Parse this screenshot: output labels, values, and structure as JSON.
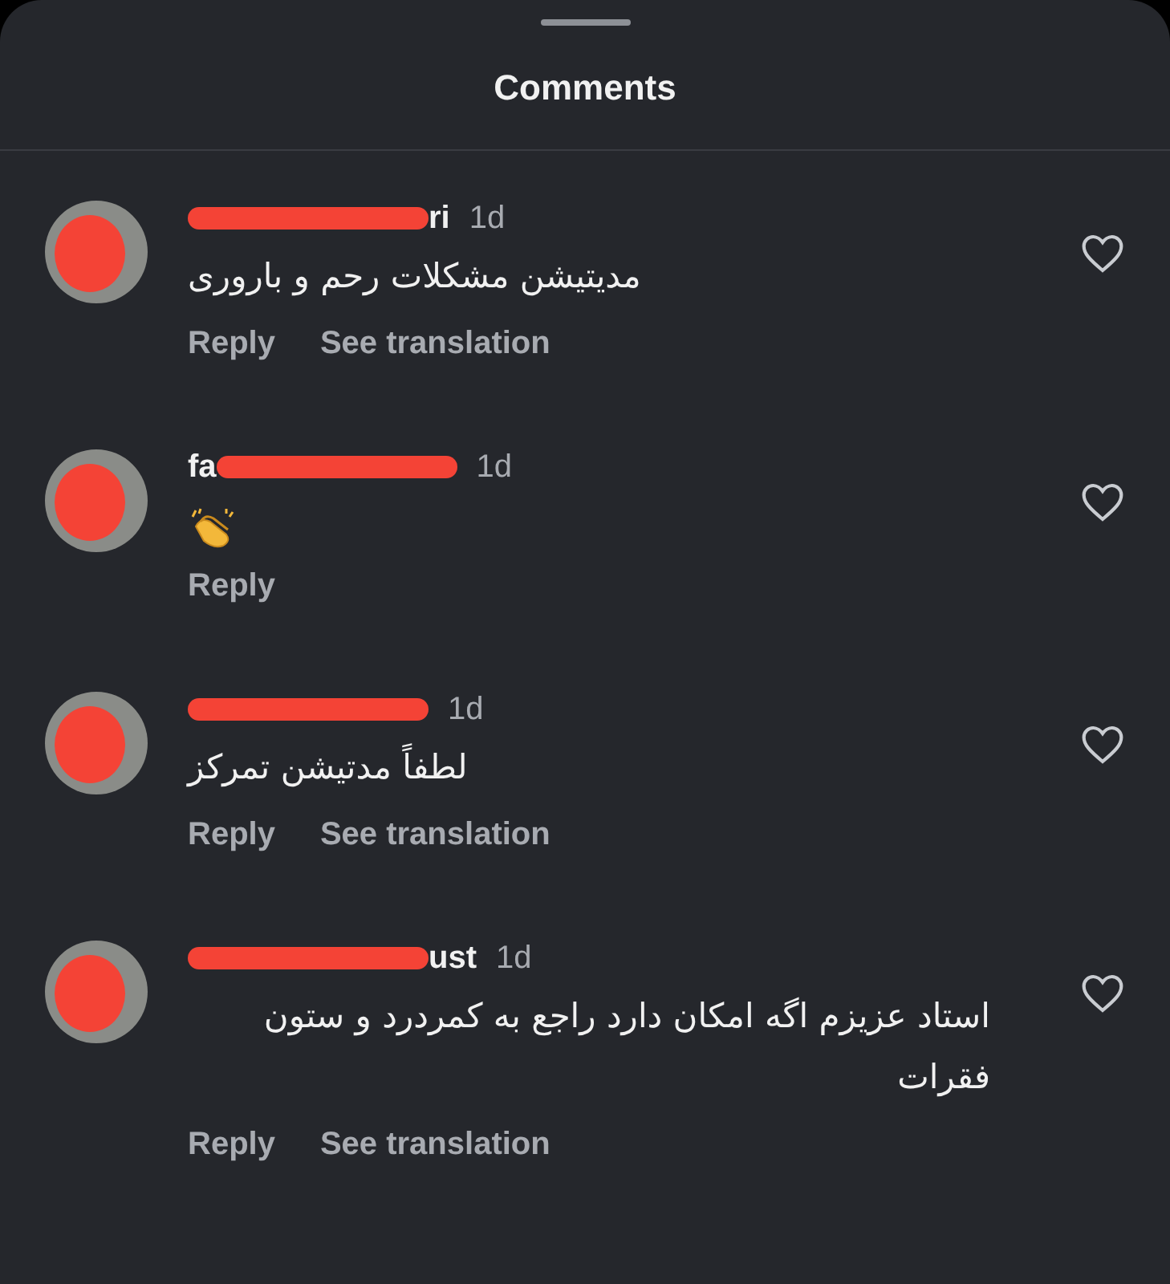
{
  "title": "Comments",
  "comments": [
    {
      "kind": "text",
      "name_after": "ri",
      "time": "1d",
      "text": "مدیتیشن مشکلات رحم و باروری",
      "liked": false,
      "reply": "Reply",
      "translate": "See translation"
    },
    {
      "kind": "clap-emoji",
      "name_before": "fa",
      "time": "1d",
      "liked": false,
      "reply": "Reply"
    },
    {
      "kind": "text",
      "time": "1d",
      "text": "لطفاً مدتیشن تمرکز",
      "liked": false,
      "reply": "Reply",
      "translate": "See translation"
    },
    {
      "kind": "text",
      "name_after": "ust",
      "time": "1d",
      "text": "استاد عزیزم اگه امکان دارد راجع به کمردرد و ستون فقرات",
      "liked": false,
      "reply": "Reply",
      "translate": "See translation"
    }
  ]
}
